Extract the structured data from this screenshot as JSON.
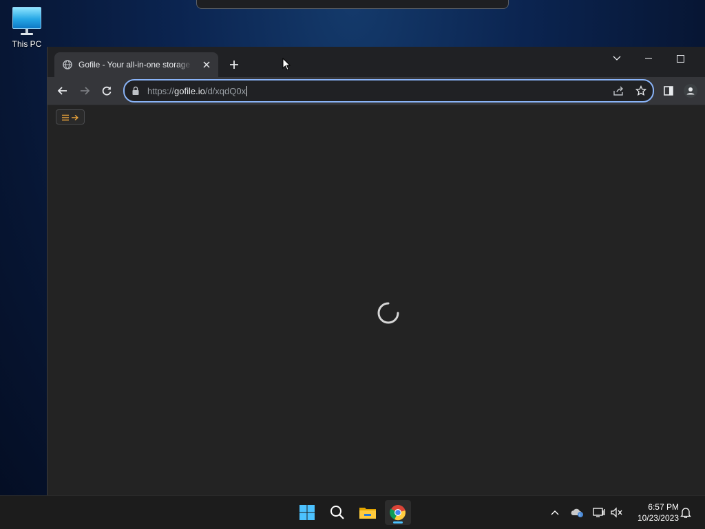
{
  "desktop": {
    "icons": [
      {
        "label": "This PC",
        "icon": "this-pc-icon"
      }
    ]
  },
  "browser": {
    "tab": {
      "title": "Gofile - Your all-in-one storage solution",
      "favicon": "globe-icon"
    },
    "new_tab_label": "+",
    "window_controls": [
      "tab-search-icon",
      "minimize-icon",
      "maximize-icon"
    ],
    "address_bar": {
      "scheme": "https://",
      "host": "gofile.io",
      "path": "/d/xqdQ0x"
    }
  },
  "page": {
    "state": "loading",
    "menu_toggle_icon": "menu-arrow-icon"
  },
  "taskbar": {
    "apps": [
      "start-icon",
      "search-icon",
      "file-explorer-icon",
      "chrome-icon"
    ],
    "active_app": "chrome-icon",
    "tray": [
      "chevron-up-icon",
      "onedrive-icon",
      "network-icon",
      "volume-muted-icon"
    ],
    "clock": {
      "time": "6:57 PM",
      "date": "10/23/2023"
    },
    "notification_icon": "bell-icon"
  },
  "colors": {
    "accent": "#8ab4f8",
    "taskbar_indicator": "#4cc2ff",
    "menu_toggle": "#e8a23a"
  }
}
